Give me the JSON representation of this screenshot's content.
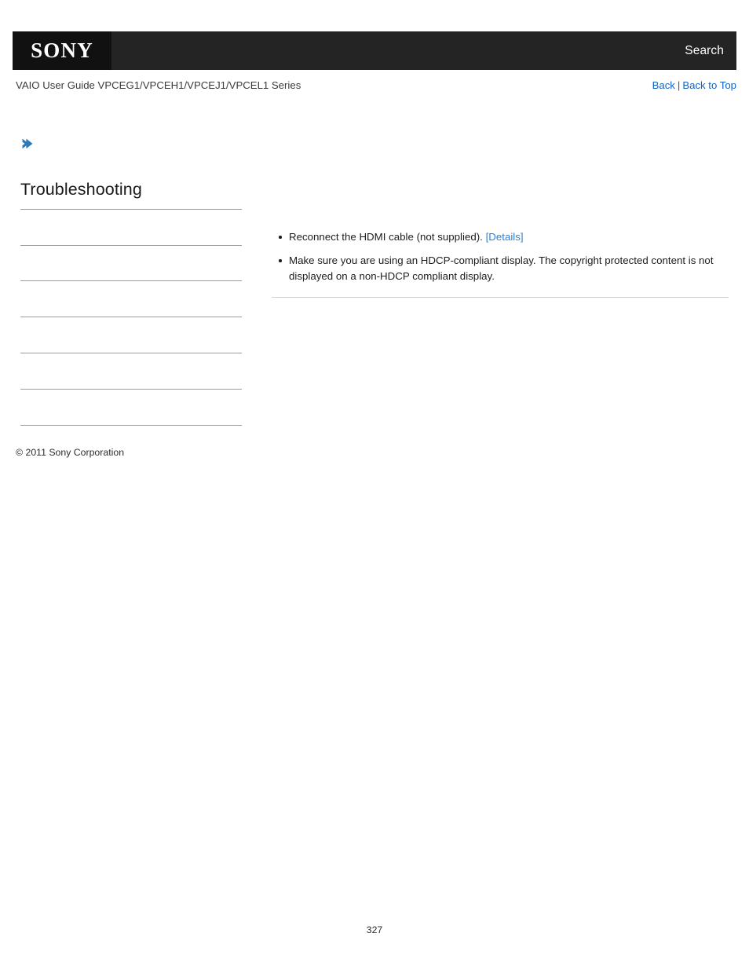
{
  "header": {
    "logo_text": "SONY",
    "logo_icon": "sony-wordmark",
    "search_label": "Search",
    "guide_title": "VAIO User Guide VPCEG1/VPCEH1/VPCEJ1/VPCEL1 Series",
    "back_label": "Back",
    "separator": "|",
    "back_to_top_label": "Back to Top"
  },
  "breadcrumb": {
    "arrow_icon": "chevron-right-icon"
  },
  "sidebar": {
    "title": "Troubleshooting",
    "items": [
      {
        "label": ""
      },
      {
        "label": ""
      },
      {
        "label": ""
      },
      {
        "label": ""
      },
      {
        "label": ""
      },
      {
        "label": ""
      }
    ],
    "copyright": "© 2011 Sony Corporation"
  },
  "main": {
    "bullets": [
      {
        "text": "Reconnect the HDMI cable (not supplied).",
        "link_label": "[Details]"
      },
      {
        "text": "Make sure you are using an HDCP-compliant display. The copyright protected content is not displayed on a non-HDCP compliant display.",
        "link_label": ""
      }
    ]
  },
  "footer": {
    "page_number": "327"
  },
  "colors": {
    "topbar_bg": "#242424",
    "logo_bg": "#111111",
    "link_blue": "#1263c6",
    "detail_link_blue": "#2f7fd0",
    "arrow_blue": "#2a7ab9",
    "rule_gray": "#9c9c9c",
    "content_rule_gray": "#cfcfcf"
  }
}
